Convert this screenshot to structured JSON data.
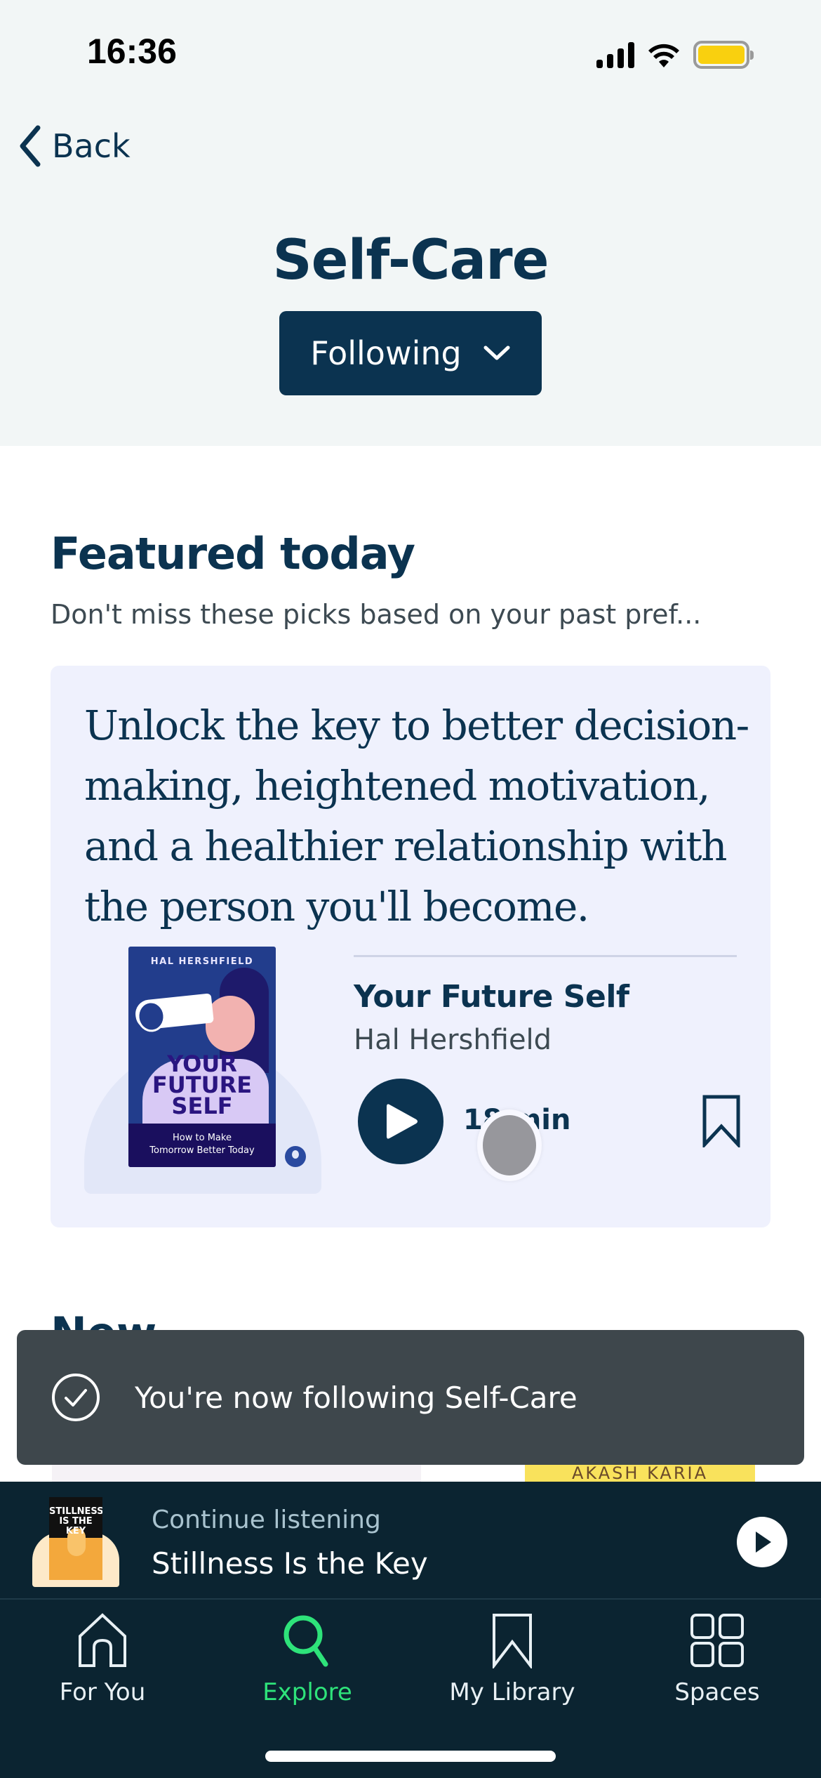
{
  "status_bar": {
    "time": "16:36",
    "icons": [
      "cellular-signal-icon",
      "wifi-icon",
      "battery-icon"
    ],
    "battery_color": "#f9d00f"
  },
  "nav": {
    "back_label": "Back"
  },
  "header": {
    "title": "Self-Care",
    "follow_button_label": "Following",
    "follow_button_icon": "chevron-down-icon"
  },
  "featured": {
    "title": "Featured today",
    "subtitle": "Don't miss these picks based on your past pref...",
    "card": {
      "blurb": "Unlock the key to better decision-making, heightened motivation, and a healthier relationship with the person you'll become.",
      "book": {
        "title": "Your Future Self",
        "author": "Hal Hershfield",
        "duration": "18 min",
        "cover": {
          "author": "HAL HERSHFIELD",
          "title_line1": "YOUR",
          "title_line2": "FUTURE",
          "title_line3": "SELF",
          "subtitle_line1": "How to Make",
          "subtitle_line2": "Tomorrow Better Today"
        }
      }
    }
  },
  "next_section": {
    "title_partial": "New",
    "peek_right_cover_text": "AKASH KARIA"
  },
  "toast": {
    "message": "You're now following Self-Care",
    "icon": "check-circle-icon"
  },
  "mini_player": {
    "label": "Continue listening",
    "title": "Stillness Is the Key",
    "cover_text_line1": "STILLNESS",
    "cover_text_line2": "IS THE KEY"
  },
  "tab_bar": {
    "tabs": [
      {
        "label": "For You",
        "icon": "home-icon",
        "active": false
      },
      {
        "label": "Explore",
        "icon": "search-icon",
        "active": true
      },
      {
        "label": "My Library",
        "icon": "bookmark-icon",
        "active": false
      },
      {
        "label": "Spaces",
        "icon": "grid-icon",
        "active": false
      }
    ],
    "active_color": "#2ee37a"
  },
  "colors": {
    "brand_navy": "#0b3350",
    "header_bg": "#f2f6f6",
    "card_bg": "#eff1fd",
    "toast_bg": "#3e474c",
    "player_bg": "#0b2431"
  }
}
